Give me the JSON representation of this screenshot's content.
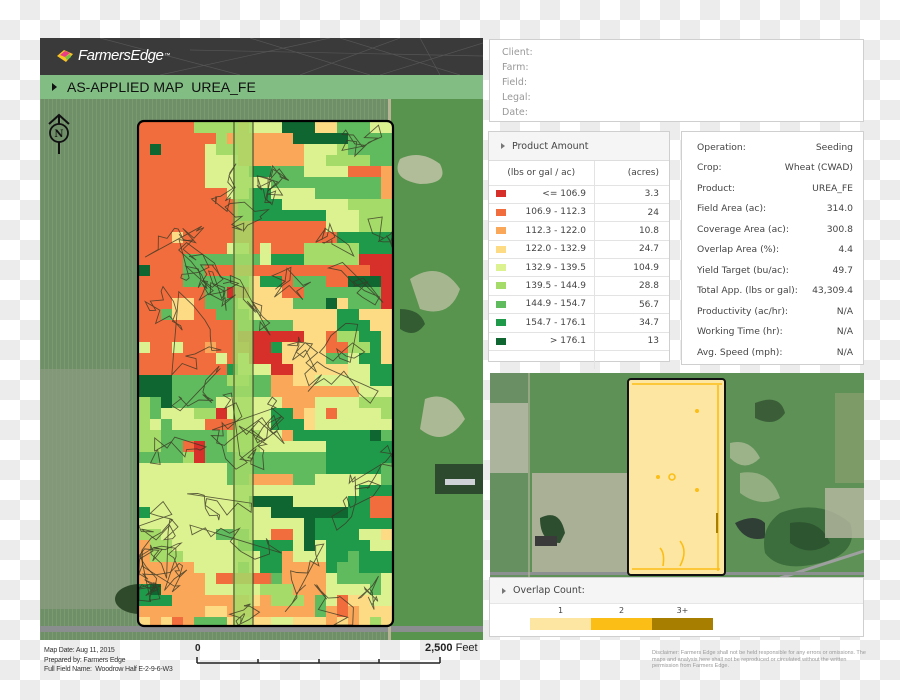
{
  "header": {
    "brand": "FarmersEdge",
    "brand_tm": "™",
    "logo_icon": "farmers-edge-logo-icon",
    "title": "AS-APPLIED MAP  UREA_FE"
  },
  "info": {
    "fields": [
      "Client:",
      "Farm:",
      "Field:",
      "Legal:",
      "Date:"
    ]
  },
  "legend": {
    "title": "Product Amount",
    "col1": "(lbs or gal / ac)",
    "col2": "(acres)",
    "rows": [
      {
        "range": "<= 106.9",
        "acres": "3.3",
        "color": "#d7302a"
      },
      {
        "range": "106.9 - 112.3",
        "acres": "24",
        "color": "#f26d3d"
      },
      {
        "range": "112.3 - 122.0",
        "acres": "10.8",
        "color": "#fba75a"
      },
      {
        "range": "122.0 - 132.9",
        "acres": "24.7",
        "color": "#fddb85"
      },
      {
        "range": "132.9 - 139.5",
        "acres": "104.9",
        "color": "#dcf18f"
      },
      {
        "range": "139.5 - 144.9",
        "acres": "28.8",
        "color": "#a5db68"
      },
      {
        "range": "144.9 - 154.7",
        "acres": "56.7",
        "color": "#5fbb5d"
      },
      {
        "range": "154.7 - 176.1",
        "acres": "34.7",
        "color": "#1f9a4a"
      },
      {
        "range": "> 176.1",
        "acres": "13",
        "color": "#0f6630"
      }
    ]
  },
  "stats": [
    {
      "label": "Operation:",
      "value": "Seeding"
    },
    {
      "label": "Crop:",
      "value": "Wheat (CWAD)"
    },
    {
      "label": "Product:",
      "value": "UREA_FE"
    },
    {
      "label": "Field Area (ac):",
      "value": "314.0"
    },
    {
      "label": "Coverage Area (ac):",
      "value": "300.8"
    },
    {
      "label": "Overlap Area (%):",
      "value": "4.4"
    },
    {
      "label": "Yield Target (bu/ac):",
      "value": "49.7"
    },
    {
      "label": "Total App. (lbs or gal):",
      "value": "43,309.4"
    },
    {
      "label": "Productivity (ac/hr):",
      "value": "N/A"
    },
    {
      "label": "Working Time (hr):",
      "value": "N/A"
    },
    {
      "label": "Avg. Speed (mph):",
      "value": "N/A"
    }
  ],
  "overlap": {
    "title": "Overlap Count:",
    "levels": [
      {
        "label": "1",
        "color": "#fde6a2"
      },
      {
        "label": "2",
        "color": "#fbbe16"
      },
      {
        "label": "3+",
        "color": "#a87e00"
      }
    ]
  },
  "map": {
    "north_label": "N",
    "north_icon": "north-arrow-icon"
  },
  "footer": {
    "map_date": "Map Date: Aug 11, 2015",
    "prepared_by": "Prepared by: Farmers Edge",
    "full_field_name": "Full Field Name:  Woodrow Half E-2-9-6-W3",
    "scale_start": "0",
    "scale_end": "2,500",
    "scale_unit": "Feet",
    "disclaimer": "Disclaimer: Farmers Edge shall not be held responsible for any errors or omissions.  The maps and analysis here shall not be reproduced or circulated without the written permission from Farmers Edge."
  }
}
